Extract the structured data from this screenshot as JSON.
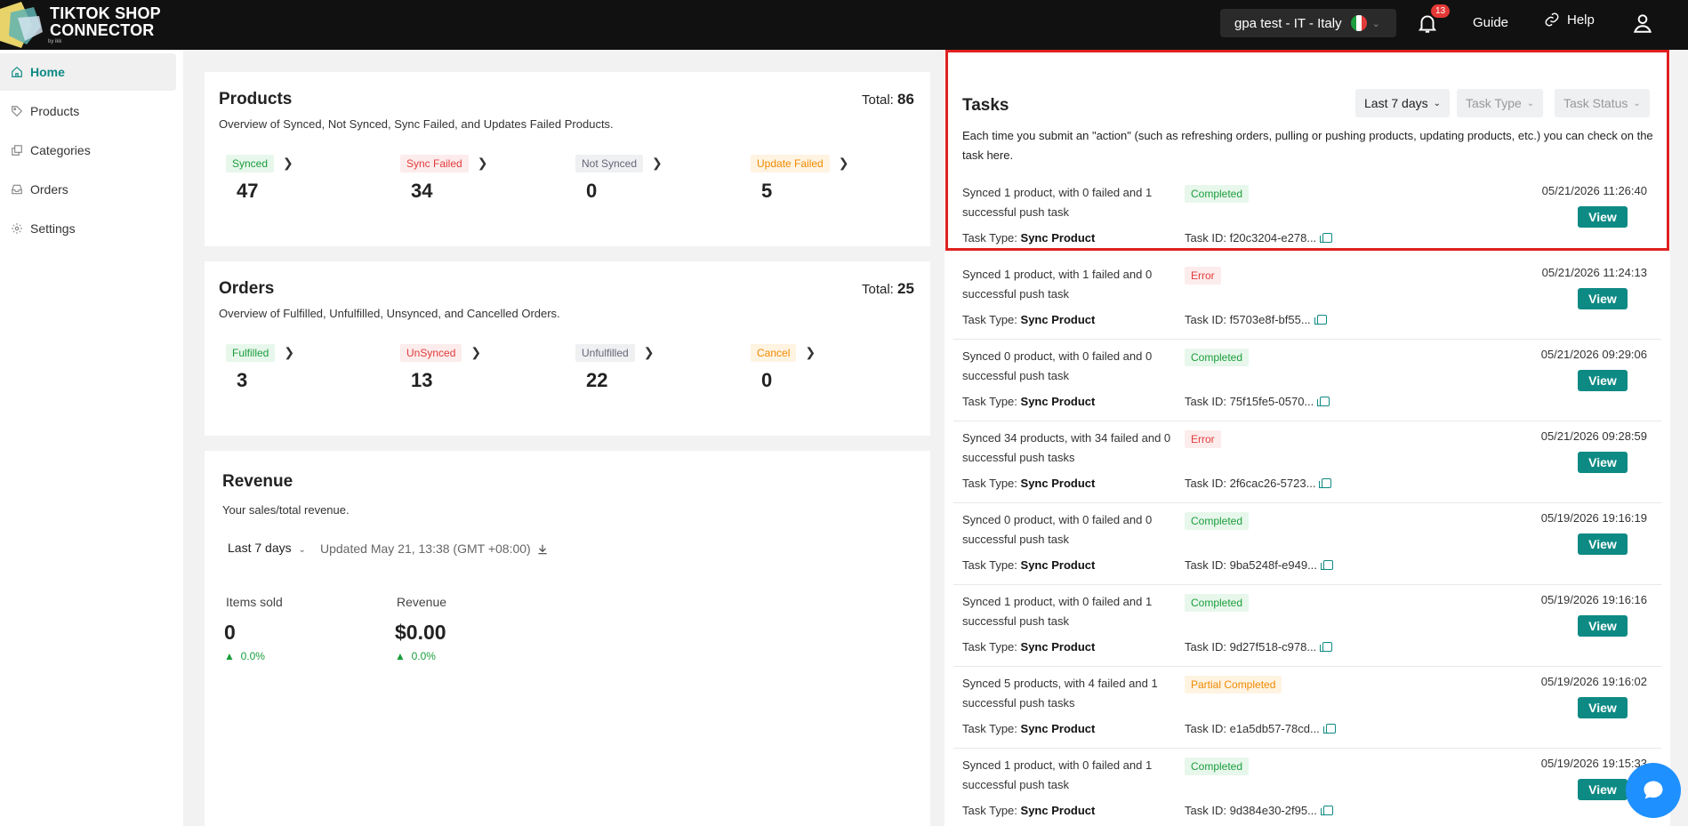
{
  "brand": {
    "line1": "TIKTOK SHOP",
    "line2": "CONNECTOR",
    "sub": "by ikk"
  },
  "topbar": {
    "store": "gpa test - IT  -  Italy",
    "notification_count": "13",
    "guide": "Guide",
    "help": "Help"
  },
  "sidebar": {
    "items": [
      {
        "label": "Home",
        "icon": "home-icon",
        "active": true
      },
      {
        "label": "Products",
        "icon": "tag-icon"
      },
      {
        "label": "Categories",
        "icon": "copy-icon"
      },
      {
        "label": "Orders",
        "icon": "inbox-icon"
      },
      {
        "label": "Settings",
        "icon": "gear-icon"
      }
    ]
  },
  "products": {
    "title": "Products",
    "total_label": "Total:",
    "total": "86",
    "desc": "Overview of Synced, Not Synced, Sync Failed, and Updates Failed Products.",
    "stats": [
      {
        "label": "Synced",
        "value": "47",
        "color": "green"
      },
      {
        "label": "Sync Failed",
        "value": "34",
        "color": "red"
      },
      {
        "label": "Not Synced",
        "value": "0",
        "color": "gray"
      },
      {
        "label": "Update Failed",
        "value": "5",
        "color": "orange"
      }
    ]
  },
  "orders": {
    "title": "Orders",
    "total_label": "Total:",
    "total": "25",
    "desc": "Overview of Fulfilled, Unfulfilled, Unsynced, and Cancelled Orders.",
    "stats": [
      {
        "label": "Fulfilled",
        "value": "3",
        "color": "green"
      },
      {
        "label": "UnSynced",
        "value": "13",
        "color": "red"
      },
      {
        "label": "Unfulfilled",
        "value": "22",
        "color": "gray"
      },
      {
        "label": "Cancel",
        "value": "0",
        "color": "orange"
      }
    ]
  },
  "revenue": {
    "title": "Revenue",
    "desc": "Your sales/total revenue.",
    "range": "Last 7 days",
    "updated": "Updated May 21, 13:38 (GMT +08:00)",
    "items_sold_label": "Items sold",
    "items_sold": "0",
    "items_delta": "0.0%",
    "revenue_label": "Revenue",
    "revenue_value": "$0.00",
    "revenue_delta": "0.0%"
  },
  "tasks": {
    "title": "Tasks",
    "filters": [
      "Last 7 days",
      "Task Type",
      "Task Status"
    ],
    "desc": "Each time you submit an \"action\" (such as refreshing orders, pulling or pushing products, updating products, etc.) you can check on the task here.",
    "type_label": "Task Type:",
    "id_label": "Task ID:",
    "view_label": "View",
    "rows": [
      {
        "text": "Synced 1 product, with 0 failed and 1 successful push task",
        "status": "Completed",
        "status_color": "green",
        "time": "05/21/2026 11:26:40",
        "type": "Sync Product",
        "id": "f20c3204-e278..."
      },
      {
        "text": "Synced 1 product, with 1 failed and 0 successful push task",
        "status": "Error",
        "status_color": "red",
        "time": "05/21/2026 11:24:13",
        "type": "Sync Product",
        "id": "f5703e8f-bf55..."
      },
      {
        "text": "Synced 0 product, with 0 failed and 0 successful push task",
        "status": "Completed",
        "status_color": "green",
        "time": "05/21/2026 09:29:06",
        "type": "Sync Product",
        "id": "75f15fe5-0570..."
      },
      {
        "text": "Synced 34 products, with 34 failed and 0 successful push tasks",
        "status": "Error",
        "status_color": "red",
        "time": "05/21/2026 09:28:59",
        "type": "Sync Product",
        "id": "2f6cac26-5723..."
      },
      {
        "text": "Synced 0 product, with 0 failed and 0 successful push task",
        "status": "Completed",
        "status_color": "green",
        "time": "05/19/2026 19:16:19",
        "type": "Sync Product",
        "id": "9ba5248f-e949..."
      },
      {
        "text": "Synced 1 product, with 0 failed and 1 successful push task",
        "status": "Completed",
        "status_color": "green",
        "time": "05/19/2026 19:16:16",
        "type": "Sync Product",
        "id": "9d27f518-c978..."
      },
      {
        "text": "Synced 5 products, with 4 failed and 1 successful push tasks",
        "status": "Partial Completed",
        "status_color": "orange",
        "time": "05/19/2026 19:16:02",
        "type": "Sync Product",
        "id": "e1a5db57-78cd..."
      },
      {
        "text": "Synced 1 product, with 0 failed and 1 successful push task",
        "status": "Completed",
        "status_color": "green",
        "time": "05/19/2026 19:15:33",
        "type": "Sync Product",
        "id": "9d384e30-2f95..."
      }
    ]
  },
  "colors": {
    "accent": "#0e8a84",
    "highlight": "#e02020",
    "chat": "#1e90ff"
  }
}
